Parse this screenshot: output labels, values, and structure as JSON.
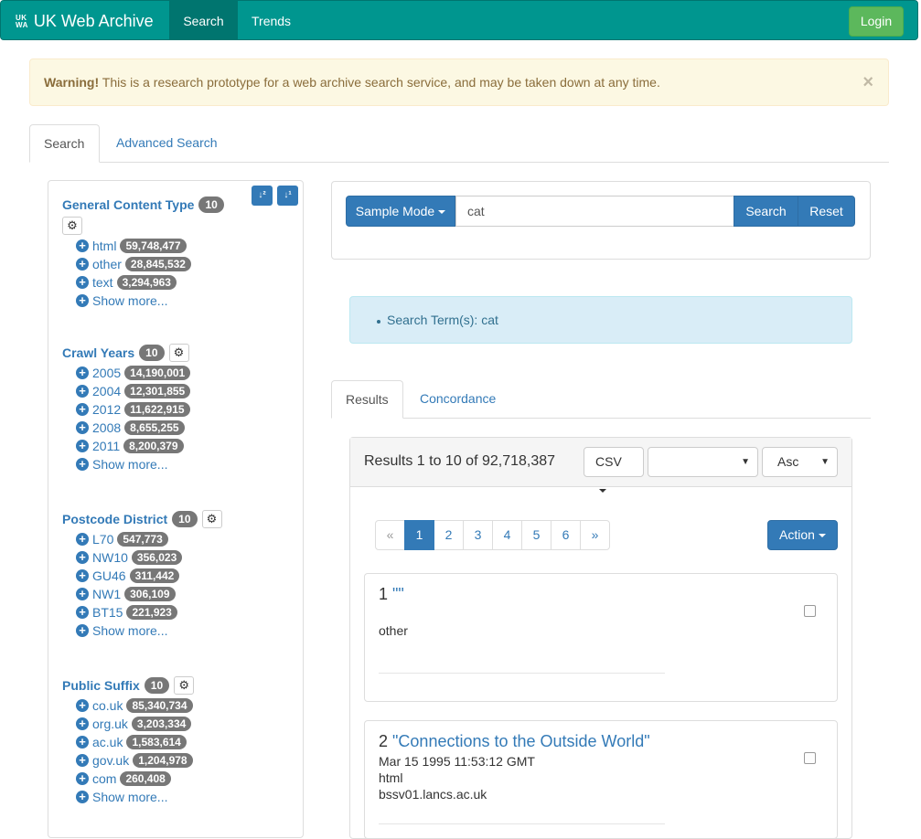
{
  "navbar": {
    "logo_top": "UK",
    "logo_bottom": "WA",
    "brand": "UK Web Archive",
    "items": [
      "Search",
      "Trends"
    ],
    "login": "Login"
  },
  "alert": {
    "strong": "Warning!",
    "text": " This is a research prototype for a web archive search service, and may be taken down at any time.",
    "close": "×"
  },
  "tabs": [
    "Search",
    "Advanced Search"
  ],
  "facets": [
    {
      "title": "General Content Type",
      "count": "10",
      "items": [
        {
          "label": "html",
          "count": "59,748,477"
        },
        {
          "label": "other",
          "count": "28,845,532"
        },
        {
          "label": "text",
          "count": "3,294,963"
        }
      ],
      "more": "Show more..."
    },
    {
      "title": "Crawl Years",
      "count": "10",
      "items": [
        {
          "label": "2005",
          "count": "14,190,001"
        },
        {
          "label": "2004",
          "count": "12,301,855"
        },
        {
          "label": "2012",
          "count": "11,622,915"
        },
        {
          "label": "2008",
          "count": "8,655,255"
        },
        {
          "label": "2011",
          "count": "8,200,379"
        }
      ],
      "more": "Show more..."
    },
    {
      "title": "Postcode District",
      "count": "10",
      "items": [
        {
          "label": "L70",
          "count": "547,773"
        },
        {
          "label": "NW10",
          "count": "356,023"
        },
        {
          "label": "GU46",
          "count": "311,442"
        },
        {
          "label": "NW1",
          "count": "306,109"
        },
        {
          "label": "BT15",
          "count": "221,923"
        }
      ],
      "more": "Show more..."
    },
    {
      "title": "Public Suffix",
      "count": "10",
      "items": [
        {
          "label": "co.uk",
          "count": "85,340,734"
        },
        {
          "label": "org.uk",
          "count": "3,203,334"
        },
        {
          "label": "ac.uk",
          "count": "1,583,614"
        },
        {
          "label": "gov.uk",
          "count": "1,204,978"
        },
        {
          "label": "com",
          "count": "260,408"
        }
      ],
      "more": "Show more..."
    }
  ],
  "search": {
    "mode": "Sample Mode",
    "query": "cat",
    "search_btn": "Search",
    "reset_btn": "Reset"
  },
  "info": {
    "term": "Search Term(s): cat"
  },
  "results_tabs": [
    "Results",
    "Concordance"
  ],
  "results": {
    "summary": "Results 1 to 10 of 92,718,387",
    "export": "CSV",
    "sort_field": "",
    "sort_order": "Asc",
    "pages": [
      "«",
      "1",
      "2",
      "3",
      "4",
      "5",
      "6",
      "»"
    ],
    "current_page": "1",
    "action": "Action",
    "items": [
      {
        "num": "1",
        "title": "\"\"",
        "lines": [
          "other"
        ]
      },
      {
        "num": "2",
        "title": "\"Connections to the Outside World\"",
        "lines": [
          "Mar 15 1995 11:53:12 GMT",
          "html",
          "bssv01.lancs.ac.uk"
        ]
      }
    ]
  }
}
